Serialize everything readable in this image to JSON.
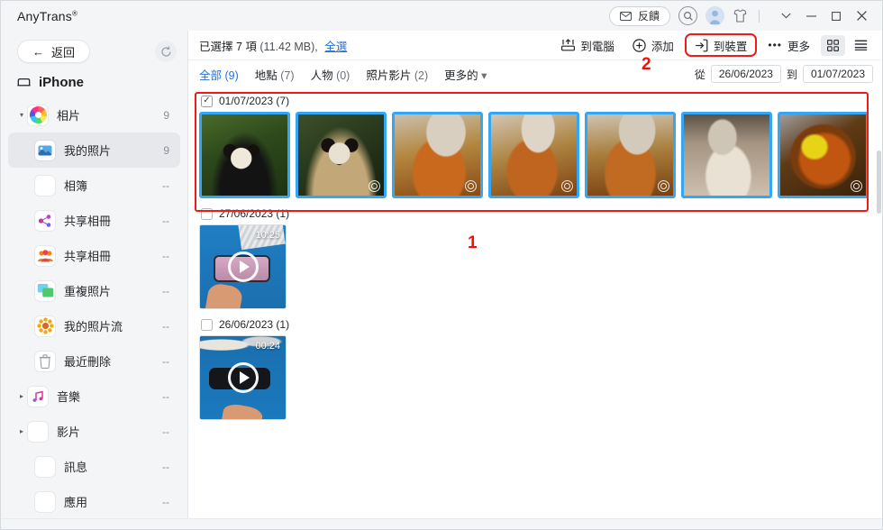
{
  "window": {
    "brand": "AnyTrans",
    "brand_reg": "®",
    "feedback_label": "反饋",
    "icons": {
      "envelope": "envelope-icon",
      "search": "search-icon",
      "avatar": "avatar-icon",
      "theme": "shirt-icon",
      "chevron_down": "chevron-down-icon",
      "minimize": "minimize-icon",
      "maximize": "maximize-icon",
      "close": "close-icon"
    },
    "minimize": "–",
    "maximize": "□",
    "close": "✕",
    "chevron": "⌄"
  },
  "sidebar": {
    "back_label": "返回",
    "back_arrow": "←",
    "refresh_icon": "refresh-icon",
    "device_name": "iPhone",
    "items": [
      {
        "label": "相片",
        "count": "9",
        "icon": "photos-icon",
        "level": "root",
        "twisty": "▾",
        "selected": false
      },
      {
        "label": "我的照片",
        "count": "9",
        "icon": "my-photos-icon",
        "level": "child",
        "twisty": "",
        "selected": true
      },
      {
        "label": "相簿",
        "count": "--",
        "icon": "album-icon",
        "level": "child",
        "twisty": "",
        "selected": false
      },
      {
        "label": "共享相冊",
        "count": "--",
        "icon": "shared-links-icon",
        "level": "child",
        "twisty": "",
        "selected": false
      },
      {
        "label": "共享相冊",
        "count": "--",
        "icon": "shared-people-icon",
        "level": "child",
        "twisty": "",
        "selected": false
      },
      {
        "label": "重複照片",
        "count": "--",
        "icon": "duplicate-icon",
        "level": "child",
        "twisty": "",
        "selected": false
      },
      {
        "label": "我的照片流",
        "count": "--",
        "icon": "photo-stream-icon",
        "level": "child",
        "twisty": "",
        "selected": false
      },
      {
        "label": "最近刪除",
        "count": "--",
        "icon": "trash-icon",
        "level": "child",
        "twisty": "",
        "selected": false
      },
      {
        "label": "音樂",
        "count": "--",
        "icon": "music-icon",
        "level": "root",
        "twisty": "▸",
        "selected": false
      },
      {
        "label": "影片",
        "count": "--",
        "icon": "video-icon",
        "level": "root",
        "twisty": "▸",
        "selected": false
      },
      {
        "label": "訊息",
        "count": "--",
        "icon": "messages-icon",
        "level": "root2",
        "twisty": "",
        "selected": false
      },
      {
        "label": "應用",
        "count": "--",
        "icon": "apps-icon",
        "level": "root2",
        "twisty": "",
        "selected": false
      }
    ]
  },
  "toolbar": {
    "selection_text": "已選擇 7 項",
    "selection_size": "(11.42 MB),",
    "select_all_label": "全選",
    "to_computer_label": "到電腦",
    "add_label": "添加",
    "to_device_label": "到裝置",
    "more_label": "更多",
    "more_dots": "•••",
    "grid_view_icon": "grid-view-icon",
    "list_view_icon": "list-view-icon"
  },
  "filters": {
    "tabs": [
      {
        "label": "全部",
        "count": "(9)",
        "active": true
      },
      {
        "label": "地點",
        "count": "(7)",
        "active": false
      },
      {
        "label": "人物",
        "count": "(0)",
        "active": false
      },
      {
        "label": "照片影片",
        "count": "(2)",
        "active": false
      },
      {
        "label": "更多的",
        "count": "▾",
        "active": false
      }
    ],
    "from_label": "從",
    "from_date": "26/06/2023",
    "to_label": "到",
    "to_date": "01/07/2023"
  },
  "groups": [
    {
      "date": "01/07/2023 (7)",
      "checked": true,
      "items": [
        {
          "name": "panda-photo-1",
          "art": "panda1",
          "selected": true,
          "badge": false,
          "kind": "photo"
        },
        {
          "name": "panda-photo-2",
          "art": "panda2",
          "selected": true,
          "badge": true,
          "kind": "photo"
        },
        {
          "name": "pasta-photo-1",
          "art": "pasta1",
          "selected": true,
          "badge": true,
          "kind": "photo"
        },
        {
          "name": "pasta-photo-2",
          "art": "pasta2",
          "selected": true,
          "badge": true,
          "kind": "photo"
        },
        {
          "name": "pasta-photo-3",
          "art": "pasta3",
          "selected": true,
          "badge": true,
          "kind": "photo"
        },
        {
          "name": "pasta-photo-4",
          "art": "pasta4",
          "selected": true,
          "badge": false,
          "kind": "photo"
        },
        {
          "name": "pan-photo-1",
          "art": "pan1",
          "selected": true,
          "badge": true,
          "kind": "photo"
        }
      ]
    },
    {
      "date": "27/06/2023 (1)",
      "checked": false,
      "items": [
        {
          "name": "video-thumb-1",
          "art": "vid1",
          "selected": false,
          "badge": false,
          "kind": "video",
          "duration": "10:25"
        }
      ]
    },
    {
      "date": "26/06/2023 (1)",
      "checked": false,
      "items": [
        {
          "name": "video-thumb-2",
          "art": "vid2",
          "selected": false,
          "badge": false,
          "kind": "video",
          "duration": "00:24"
        }
      ]
    }
  ],
  "annotations": [
    {
      "label": "1"
    },
    {
      "label": "2"
    }
  ],
  "colors": {
    "accent": "#1a73e8",
    "selection_border": "#33a7f5",
    "annotation_red": "#ee1b16",
    "sidebar_bg": "#f4f5f7"
  }
}
